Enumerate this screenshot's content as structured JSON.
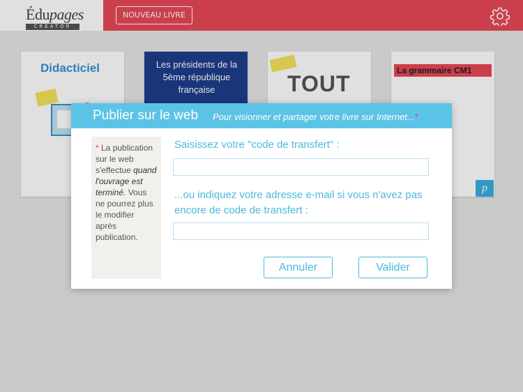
{
  "app": {
    "logo_main": "Édu",
    "logo_italic": "pages",
    "logo_sub": "CREATOR",
    "new_book_label": "NOUVEAU LIVRE"
  },
  "library": {
    "books": [
      {
        "title": "Didacticiel"
      },
      {
        "title": "Les présidents de la 5ème république française"
      },
      {
        "title": "TOUT"
      },
      {
        "title": "La grammaire CM1",
        "badge": "p"
      }
    ]
  },
  "dialog": {
    "title": "Publier sur le web",
    "subtitle": "Pour visionner et partager votre livre sur Internet...",
    "subtitle_star": "*",
    "note": {
      "star": "*",
      "part1": " La publication sur le web s'effectue ",
      "emphasis": "quand l'ouvrage est terminé.",
      "part2": " Vous ne pourrez plus le modifier après publication."
    },
    "transfer_label": "Saisissez votre \"code de transfert\" :",
    "transfer_value": "",
    "email_label": "...ou indiquez votre adresse e-mail si vous n'avez pas encore de code de transfert :",
    "email_value": "",
    "cancel_label": "Annuler",
    "ok_label": "Valider"
  },
  "colors": {
    "header": "#e84857",
    "accent": "#5bc3e5"
  },
  "icons": {
    "settings": "gear-icon"
  }
}
